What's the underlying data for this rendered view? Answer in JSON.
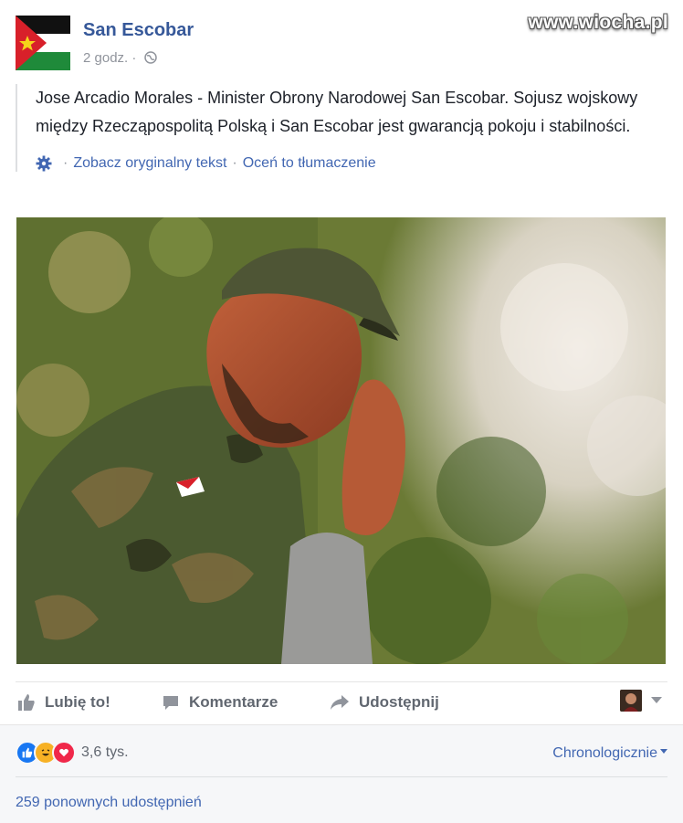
{
  "header": {
    "page_name": "San Escobar",
    "time": "2 godz.",
    "separator": "·",
    "watermark": "www.wiocha.pl"
  },
  "post": {
    "text": "Jose Arcadio Morales - Minister Obrony Narodowej San Escobar. Sojusz wojskowy między Rzecząpospolitą Polską i San Escobar jest gwarancją pokoju i stabilności.",
    "see_original": "Zobacz oryginalny tekst",
    "rate_translation": "Oceń to tłumaczenie",
    "dot": "·"
  },
  "actions": {
    "like": "Lubię to!",
    "comment": "Komentarze",
    "share": "Udostępnij"
  },
  "footer": {
    "reaction_count": "3,6 tys.",
    "sort_label": "Chronologicznie",
    "shares": "259 ponownych udostępnień"
  },
  "icons": {
    "flag": "san-escobar-flag-icon",
    "globe": "globe-icon",
    "gear": "gear-icon",
    "like": "thumbs-up-icon",
    "comment": "comment-icon",
    "share": "share-arrow-icon",
    "reactions": [
      "like-reaction-icon",
      "haha-reaction-icon",
      "love-reaction-icon"
    ]
  },
  "colors": {
    "link": "#365899",
    "blue": "#4267b2",
    "muted": "#90949c"
  }
}
